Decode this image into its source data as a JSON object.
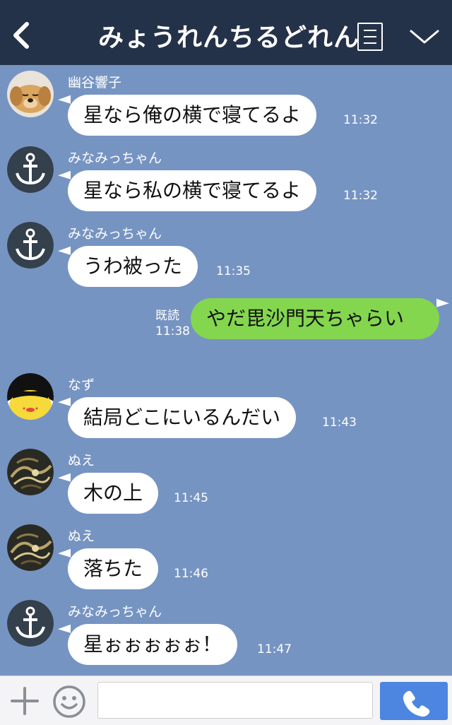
{
  "header": {
    "title": "みょうれんちるどれん",
    "bg_color": "#243249",
    "icons": [
      "back-chevron-icon",
      "menu-icon",
      "chevron-down-icon"
    ]
  },
  "chat": {
    "bg_color": "#7694c2",
    "messages": [
      {
        "sender": "幽谷響子",
        "text": "星なら俺の横で寝てるよ",
        "time": "11:32",
        "avatar": "puppy-avatar"
      },
      {
        "sender": "みなみっちゃん",
        "text": "星なら私の横で寝てるよ",
        "time": "11:32",
        "avatar": "anchor-avatar"
      },
      {
        "sender": "みなみっちゃん",
        "text": "うわ被った",
        "time": "11:35",
        "avatar": "anchor-avatar"
      },
      {
        "text": "やだ毘沙門天ちゃらい",
        "read": "既読",
        "time": "11:38",
        "mine": true
      },
      {
        "sender": "なず",
        "text": "結局どこにいるんだい",
        "time": "11:43",
        "avatar": "mouse-avatar"
      },
      {
        "sender": "ぬえ",
        "text": "木の上",
        "time": "11:45",
        "avatar": "tiger-art-avatar"
      },
      {
        "sender": "ぬえ",
        "text": "落ちた",
        "time": "11:46",
        "avatar": "tiger-art-avatar"
      },
      {
        "sender": "みなみっちゃん",
        "text": "星ぉぉぉぉぉ！",
        "time": "11:47",
        "avatar": "anchor-avatar"
      }
    ]
  },
  "footer": {
    "input_value": "",
    "icons": [
      "plus-icon",
      "smiley-icon",
      "phone-icon"
    ],
    "call_color": "#4c86e0"
  },
  "colors": {
    "my_bubble": "#83d64e",
    "other_bubble": "#ffffff"
  }
}
